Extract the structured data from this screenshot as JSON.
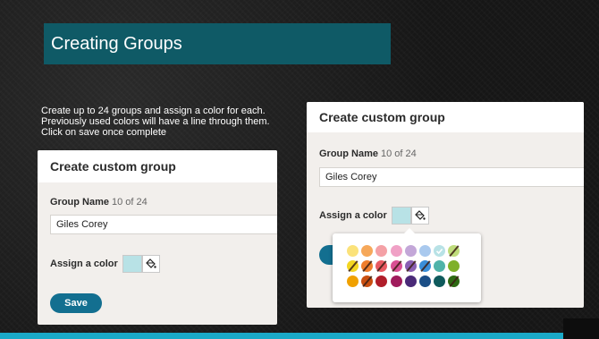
{
  "slide": {
    "title": "Creating Groups",
    "description": "Create up to 24 groups and assign a color for each.  Previously used colors will have a line through them.  Click on save once complete"
  },
  "left_dialog": {
    "title": "Create custom group",
    "name_label": "Group Name",
    "name_count": "10 of 24",
    "name_value": "Giles Corey",
    "assign_label": "Assign a color",
    "save_label": "Save"
  },
  "right_dialog": {
    "title": "Create custom group",
    "name_label": "Group Name",
    "name_count": "10 of 24",
    "name_value": "Giles Corey",
    "assign_label": "Assign a color"
  },
  "colors": {
    "accent": "#136f90",
    "title_bg": "#0f5a66",
    "selected_swatch": "#b8e2e6",
    "bottom_bar": "#1aa9c7"
  },
  "palette": {
    "row1": [
      {
        "color": "#fbe27a",
        "used": false
      },
      {
        "color": "#f6a85a",
        "used": false
      },
      {
        "color": "#f4a1a6",
        "used": false
      },
      {
        "color": "#f0a1c6",
        "used": false
      },
      {
        "color": "#c3a7d8",
        "used": false
      },
      {
        "color": "#a9c9ee",
        "used": false
      },
      {
        "color": "#b8e2e6",
        "used": false,
        "selected": true
      },
      {
        "color": "#bfdc7c",
        "used": true
      }
    ],
    "row2": [
      {
        "color": "#f3d622",
        "used": true
      },
      {
        "color": "#ef7d2b",
        "used": true
      },
      {
        "color": "#e85a62",
        "used": true
      },
      {
        "color": "#d94f93",
        "used": true
      },
      {
        "color": "#8a5fb3",
        "used": true
      },
      {
        "color": "#3a8ed8",
        "used": true
      },
      {
        "color": "#4fb3a9",
        "used": false
      },
      {
        "color": "#7fb02a",
        "used": false
      }
    ],
    "row3": [
      {
        "color": "#f0a100",
        "used": false
      },
      {
        "color": "#c94f10",
        "used": true
      },
      {
        "color": "#b01e2a",
        "used": false
      },
      {
        "color": "#a01c5c",
        "used": false
      },
      {
        "color": "#4a2a78",
        "used": false
      },
      {
        "color": "#1b4e86",
        "used": false
      },
      {
        "color": "#0f5a5c",
        "used": false
      },
      {
        "color": "#2e6a14",
        "used": true
      }
    ]
  }
}
